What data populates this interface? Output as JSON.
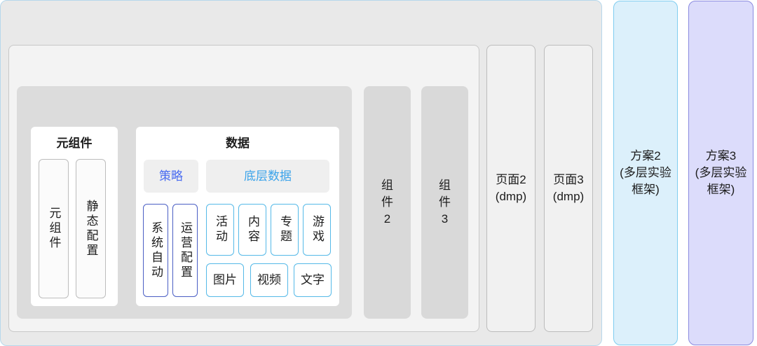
{
  "meta_component": {
    "title": "元组件",
    "sub1": "元组件",
    "sub2": "静态配置"
  },
  "data_panel": {
    "title": "数据",
    "strategy": "策略",
    "bottom_data": "底层数据",
    "sys_auto": "系统自动",
    "ops_config": "运营配置",
    "tiles": {
      "activity": "活动",
      "content": "内容",
      "topic": "专题",
      "game": "游戏",
      "image": "图片",
      "video": "视频",
      "text": "文字"
    }
  },
  "components": {
    "comp2": {
      "line1": "组",
      "line2": "件",
      "line3": "2"
    },
    "comp3": {
      "line1": "组",
      "line2": "件",
      "line3": "3"
    }
  },
  "pages": {
    "page2": {
      "line1": "页面2",
      "line2": "(dmp)"
    },
    "page3": {
      "line1": "页面3",
      "line2": "(dmp)"
    }
  },
  "plans": {
    "plan2": {
      "line1": "方案2",
      "line2": "(多层实验",
      "line3": "框架)"
    },
    "plan3": {
      "line1": "方案3",
      "line2": "(多层实验",
      "line3": "框架)"
    }
  },
  "colors": {
    "strategy_text": "#4a6cf0",
    "bottom_data_text": "#3aa3ea",
    "blue_border": "#4a5ec4",
    "cyan_border": "#55b9e8",
    "plan2_fill": "#dcf0fb",
    "plan3_fill": "#dcdcfb"
  }
}
